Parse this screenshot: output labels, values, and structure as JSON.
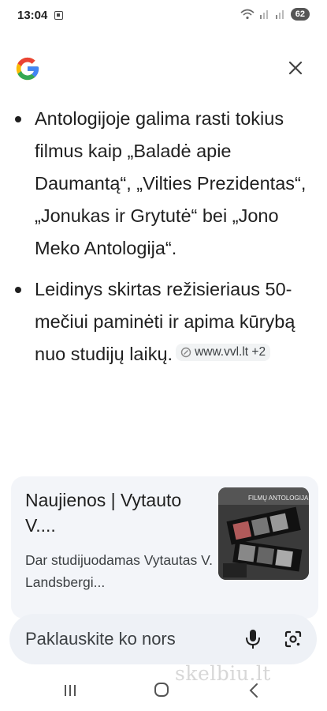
{
  "status_bar": {
    "time": "13:04",
    "battery": "62"
  },
  "bullets": [
    {
      "text": "Antologijoje galima rasti tokius filmus kaip „Baladė apie Daumantą“, „Vilties Prezidentas“, „Jonukas ir Grytutė“ bei „Jono Meko Antologija“."
    },
    {
      "text": "Leidinys skirtas režisieriaus 50-mečiui paminėti ir apima kūrybą nuo studijų laikų.",
      "source": "www.vvl.lt +2"
    }
  ],
  "news_card": {
    "title": "Naujienos | Vytauto V....",
    "snippet": "Dar studijuodamas Vytautas V. Landsbergi...",
    "thumb_caption": "FILMŲ ANTOLOGIJA"
  },
  "search": {
    "placeholder": "Paklauskite ko nors"
  },
  "watermark": "skelbiu.lt",
  "colors": {
    "google_blue": "#4285F4",
    "google_red": "#EA4335",
    "google_yellow": "#FBBC05",
    "google_green": "#34A853",
    "card_bg": "#f3f5f9",
    "search_bg": "#eef1f6"
  },
  "icons": [
    "google-logo",
    "close-icon",
    "link-icon",
    "mic-icon",
    "lens-icon",
    "recent-apps-icon",
    "home-icon",
    "back-icon",
    "wifi-icon",
    "signal-icon"
  ]
}
